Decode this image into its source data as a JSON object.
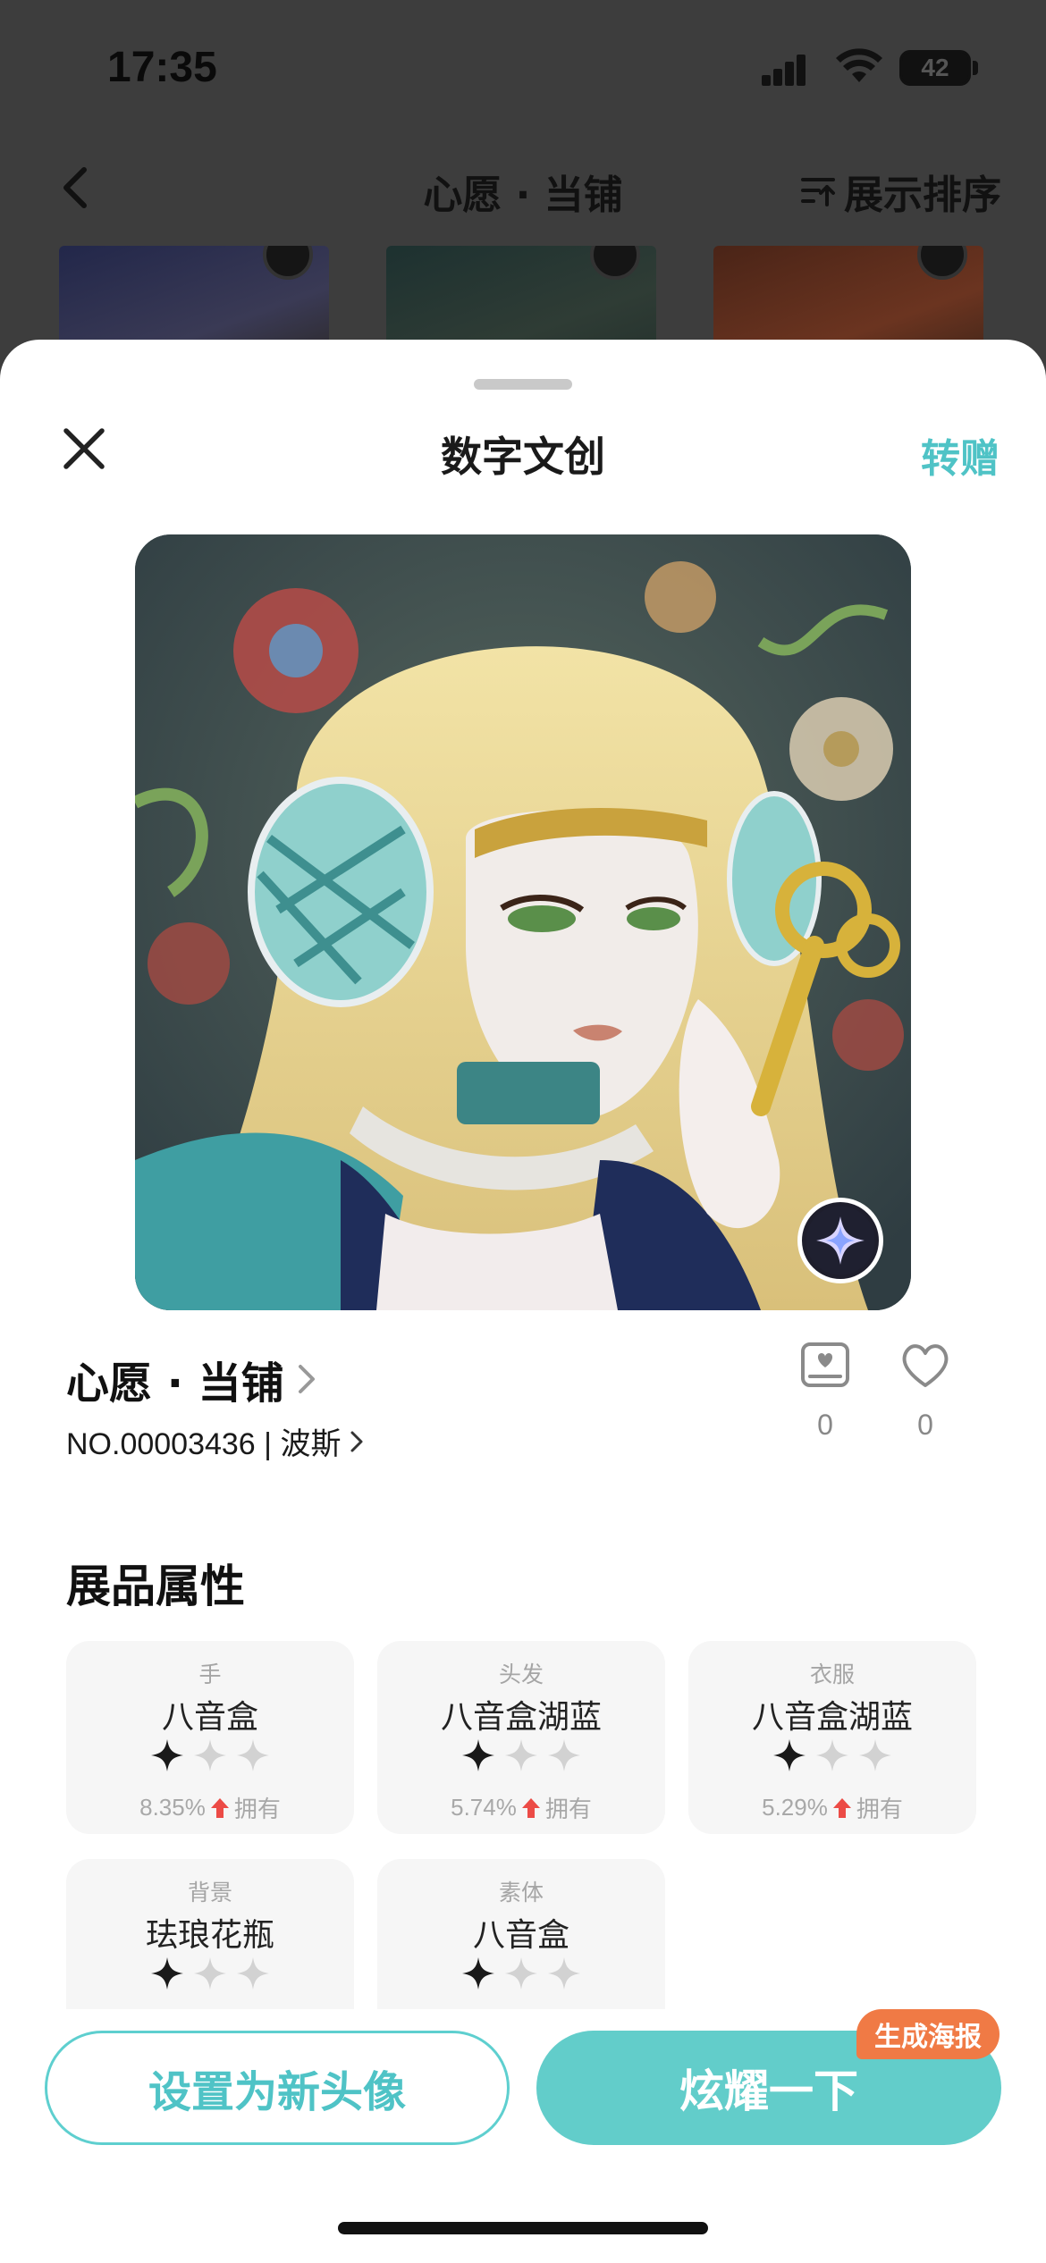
{
  "status_bar": {
    "time": "17:35",
    "battery": "42"
  },
  "background_page": {
    "title": "心愿 · 当铺",
    "sort_label": "展示排序"
  },
  "sheet": {
    "title": "数字文创",
    "gift_label": "转赠",
    "item": {
      "name": "心愿 · 当铺",
      "serial": "NO.00003436 | 波斯",
      "collect_count": "0",
      "like_count": "0"
    },
    "attributes_title": "展品属性",
    "attributes": [
      {
        "category": "手",
        "value": "八音盒",
        "stars_filled": 1,
        "stars_total": 3,
        "ratio": "8.35%",
        "own_label": "拥有"
      },
      {
        "category": "头发",
        "value": "八音盒湖蓝",
        "stars_filled": 1,
        "stars_total": 3,
        "ratio": "5.74%",
        "own_label": "拥有"
      },
      {
        "category": "衣服",
        "value": "八音盒湖蓝",
        "stars_filled": 1,
        "stars_total": 3,
        "ratio": "5.29%",
        "own_label": "拥有"
      },
      {
        "category": "背景",
        "value": "珐琅花瓶",
        "stars_filled": 1,
        "stars_total": 3,
        "ratio": "",
        "own_label": ""
      },
      {
        "category": "素体",
        "value": "八音盒",
        "stars_filled": 1,
        "stars_total": 3,
        "ratio": "",
        "own_label": ""
      }
    ]
  },
  "actions": {
    "set_avatar_label": "设置为新头像",
    "show_off_label": "炫耀一下",
    "poster_badge": "生成海报"
  },
  "colors": {
    "accent": "#62cdca",
    "accent_text": "#4fc3c6",
    "poster_badge": "#f07a45",
    "arrow_up": "#ec4b46"
  },
  "icons": [
    "back-icon",
    "sort-icon",
    "close-icon",
    "chevron-right-icon",
    "collect-icon",
    "heart-icon",
    "four-point-star-icon",
    "arrow-up-icon"
  ]
}
